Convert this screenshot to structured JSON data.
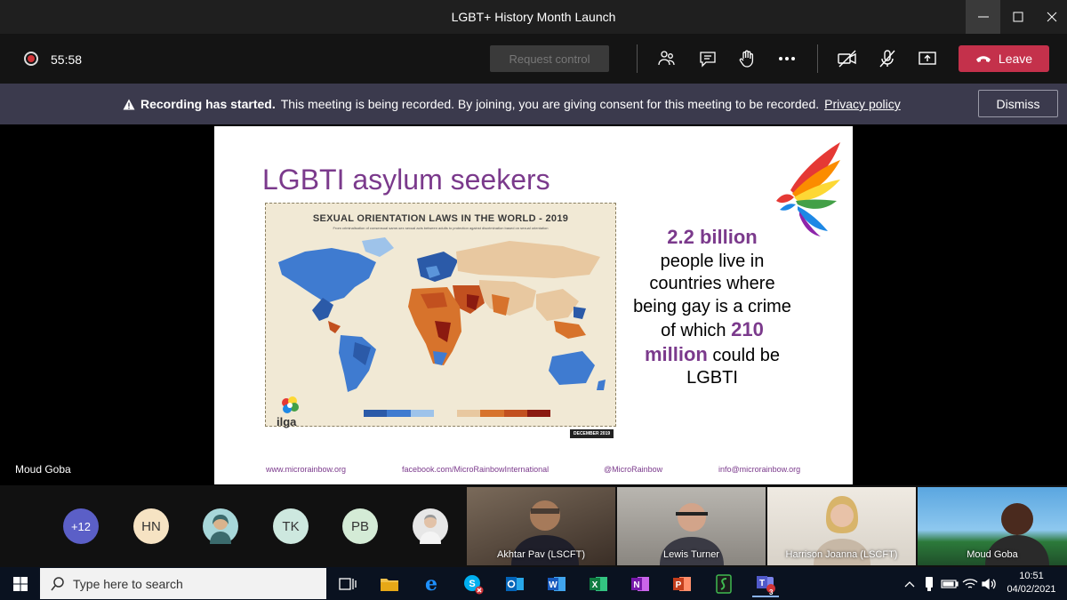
{
  "window": {
    "title": "LGBT+ History Month Launch"
  },
  "toolbar": {
    "timer": "55:58",
    "request_control_label": "Request control",
    "leave_label": "Leave"
  },
  "banner": {
    "bold": "Recording has started.",
    "message": "This meeting is being recorded. By joining, you are giving consent for this meeting to be recorded.",
    "privacy_link": "Privacy policy",
    "dismiss_label": "Dismiss"
  },
  "stage": {
    "presenter_name": "Moud Goba",
    "slide": {
      "title": "LGBTI asylum seekers",
      "map_title": "SEXUAL ORIENTATION LAWS IN THE WORLD - 2019",
      "map_subtitle": "From criminalisation of consensual same-sex sexual acts between adults to protection against discrimination based on sexual orientation",
      "map_logo": "ilga",
      "map_date": "DECEMBER 2019",
      "stat_1": "2.2 billion",
      "stat_text_1": "people live in countries where being gay is a crime of which",
      "stat_2_a": "210",
      "stat_2_b": "million",
      "stat_text_2": "could be LGBTI",
      "footer": [
        "www.microrainbow.org",
        "facebook.com/MicroRainbowInternational",
        "@MicroRainbow",
        "info@microrainbow.org"
      ]
    }
  },
  "participants": {
    "overflow": "+12",
    "avatars": [
      {
        "initials": "HN",
        "color": "#f6e3c3"
      },
      {
        "initials": "",
        "color": "#a7d7d9"
      },
      {
        "initials": "TK",
        "color": "#cde8df"
      },
      {
        "initials": "PB",
        "color": "#d4ebd6"
      },
      {
        "initials": "",
        "color": "#e7e7e7"
      }
    ],
    "tiles": [
      {
        "name": "Akhtar Pav (LSCFT)"
      },
      {
        "name": "Lewis Turner"
      },
      {
        "name": "Harrison Joanna (LSCFT)"
      },
      {
        "name": "Moud Goba"
      }
    ]
  },
  "taskbar": {
    "search_placeholder": "Type here to search",
    "time": "10:51",
    "date": "04/02/2021",
    "teams_badge": "3"
  }
}
